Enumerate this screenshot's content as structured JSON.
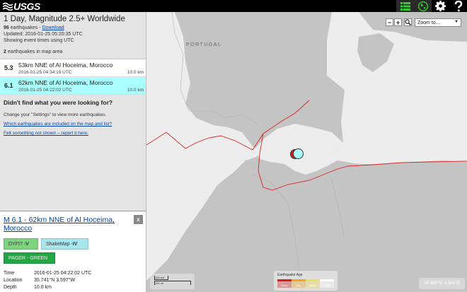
{
  "app": {
    "logo_text": "USGS",
    "icons": [
      "list-icon",
      "globe-icon",
      "gear-icon",
      "help-icon"
    ]
  },
  "summary": {
    "title": "1 Day, Magnitude 2.5+ Worldwide",
    "count": "96",
    "count_suffix": " earthquakes - ",
    "download_label": "Download",
    "updated": "Updated: 2016-01-25 05:20:35 UTC",
    "timezone_note": "Showing event times using UTC",
    "map_count": "2",
    "map_count_suffix": " earthquakes in map area"
  },
  "earthquakes": [
    {
      "mag": "5.3",
      "place": "53km NNE of Al Hoceima, Morocco",
      "time": "2016-01-25 04:34:19 UTC",
      "depth": "10.0 km",
      "selected": false
    },
    {
      "mag": "6.1",
      "place": "62km NNE of Al Hoceima, Morocco",
      "time": "2016-01-25 04:22:02 UTC",
      "depth": "10.0 km",
      "selected": true
    }
  ],
  "help": {
    "heading": "Didn't find what you were looking for?",
    "settings_note": "Change your \"Settings\" to view more earthquakes.",
    "link1": "Which earthquakes are included on the map and list?",
    "link2": "Felt something not shown – report it here."
  },
  "detail": {
    "title": "M 6.1 - 62km NNE of Al Hoceima, Morocco",
    "close_label": "x",
    "dyfi_label": "DYFI? - ",
    "dyfi_value": "V",
    "shakemap_label": "ShakeMap - ",
    "shakemap_value": "IV",
    "pager_label": "PAGER - GREEN",
    "time_key": "Time",
    "time_value": "2016-01-25 04:22:02 UTC",
    "location_key": "Location",
    "location_value": "35.741°N 3.597°W",
    "depth_key": "Depth",
    "depth_value": "10.0 km"
  },
  "map": {
    "zoom_out": "−",
    "zoom_in": "+",
    "zoom_to_label": "Zoom to...",
    "country_label": "PORTUGAL",
    "scale_km": "100 km",
    "scale_mi": "100 mi",
    "legend_title": "Earthquake Age",
    "legend_items": [
      "Hour",
      "Day",
      "Week",
      "Older"
    ],
    "legend_colors": [
      "#d61c1c",
      "#f0a61e",
      "#f0e05a",
      "#ffffff"
    ],
    "coordinates": "34.888°N, 4.504°E",
    "plate_boundary_color": "#d22"
  }
}
